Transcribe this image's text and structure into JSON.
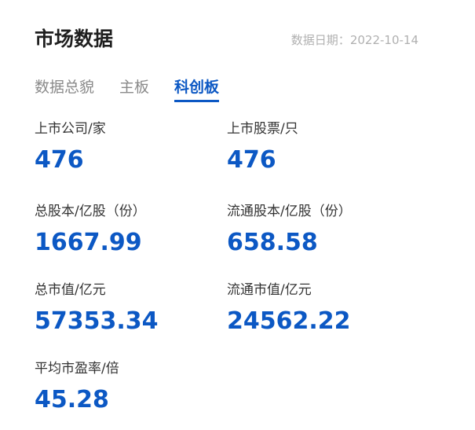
{
  "header": {
    "title": "市场数据",
    "date_label": "数据日期：",
    "date_value": "2022-10-14"
  },
  "tabs": [
    {
      "label": "数据总貌",
      "active": false
    },
    {
      "label": "主板",
      "active": false
    },
    {
      "label": "科创板",
      "active": true
    }
  ],
  "stats": {
    "listed_companies": {
      "label": "上市公司/家",
      "value": "476"
    },
    "listed_stocks": {
      "label": "上市股票/只",
      "value": "476"
    },
    "total_shares": {
      "label": "总股本/亿股（份）",
      "value": "1667.99"
    },
    "float_shares": {
      "label": "流通股本/亿股（份）",
      "value": "658.58"
    },
    "total_market_value": {
      "label": "总市值/亿元",
      "value": "57353.34"
    },
    "float_market_value": {
      "label": "流通市值/亿元",
      "value": "24562.22"
    },
    "avg_pe_ratio": {
      "label": "平均市盈率/倍",
      "value": "45.28"
    }
  },
  "colors": {
    "accent": "#0c58c4",
    "title": "#1f1f1f",
    "muted": "#8a8a8a",
    "date": "#b0b0b0",
    "label": "#333333"
  }
}
